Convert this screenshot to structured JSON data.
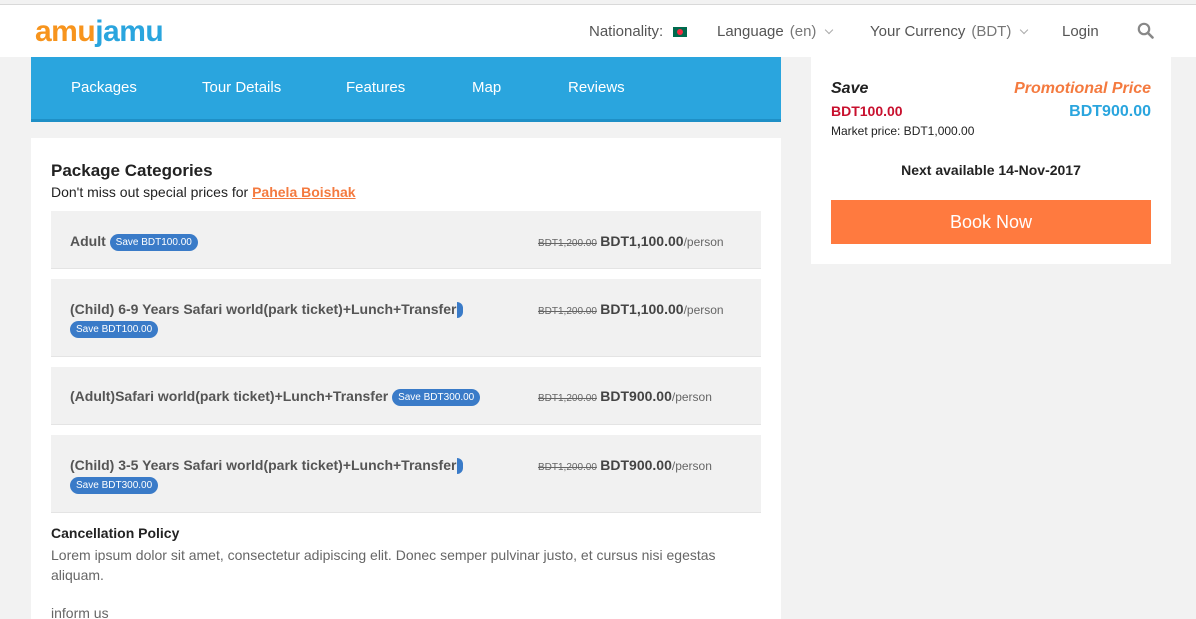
{
  "logo": {
    "part1": "amu",
    "part2": "jamu"
  },
  "header": {
    "nationality_label": "Nationality:",
    "nationality_flag": "bangladesh-flag-icon",
    "language_label": "Language",
    "language_value": "(en)",
    "currency_label": "Your Currency",
    "currency_value": "(BDT)",
    "login_label": "Login",
    "search_icon": "search-icon"
  },
  "tabs": [
    "Packages",
    "Tour Details",
    "Features",
    "Map",
    "Reviews"
  ],
  "package_categories": {
    "title": "Package Categories",
    "subtitle_prefix": "Don't miss out special prices for",
    "promo_link": "Pahela Boishak",
    "items": [
      {
        "name": "Adult",
        "badge": "Save BDT100.00",
        "old_price": "BDT1,200.00",
        "new_price": "BDT1,100.00",
        "unit": "/person"
      },
      {
        "name": "(Child) 6-9 Years Safari world(park ticket)+Lunch+Transfer",
        "badge": "Save BDT100.00",
        "old_price": "BDT1,200.00",
        "new_price": "BDT1,100.00",
        "unit": "/person"
      },
      {
        "name": "(Adult)Safari world(park ticket)+Lunch+Transfer",
        "badge": "Save BDT300.00",
        "old_price": "BDT1,200.00",
        "new_price": "BDT900.00",
        "unit": "/person"
      },
      {
        "name": "(Child) 3-5 Years Safari world(park ticket)+Lunch+Transfer",
        "badge": "Save BDT300.00",
        "old_price": "BDT1,200.00",
        "new_price": "BDT900.00",
        "unit": "/person"
      }
    ]
  },
  "cancellation": {
    "title": "Cancellation Policy",
    "text": "Lorem ipsum dolor sit amet, consectetur adipiscing elit. Donec semper pulvinar justo, et cursus nisi egestas aliquam.",
    "inform": "inform us"
  },
  "sidebar": {
    "save_label": "Save",
    "save_amount": "BDT100.00",
    "market_price": "Market price: BDT1,000.00",
    "promo_label": "Promotional Price",
    "promo_amount": "BDT900.00",
    "next_available": "Next available 14-Nov-2017",
    "book_label": "Book Now"
  },
  "colors": {
    "brand_blue": "#2aa5de",
    "brand_orange": "#f47a3f",
    "badge_blue": "#3a7bc8",
    "save_red": "#c8102e"
  }
}
